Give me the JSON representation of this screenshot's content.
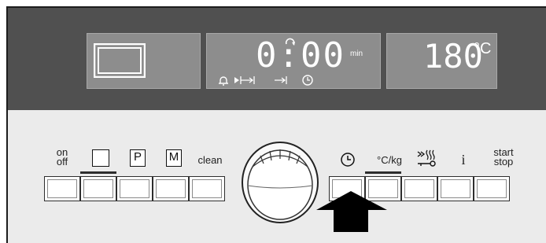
{
  "display": {
    "timer_value": "0:00",
    "timer_unit": "min",
    "timer_icons": [
      "bell-icon",
      "play-to-end-icon",
      "end-bracket-icon",
      "clock-icon"
    ],
    "temperature_value": "180",
    "temperature_unit": "°C"
  },
  "left_buttons": [
    {
      "label": "on\noff",
      "symbol": "power"
    },
    {
      "label": "",
      "symbol": "empty-square"
    },
    {
      "label": "P",
      "symbol": "boxed-letter"
    },
    {
      "label": "M",
      "symbol": "boxed-letter"
    },
    {
      "label": "clean",
      "symbol": "text"
    }
  ],
  "right_buttons": [
    {
      "label": "",
      "symbol": "clock-icon"
    },
    {
      "label": "°C/kg",
      "symbol": "text"
    },
    {
      "label": "",
      "symbol": "steam-lock-icon"
    },
    {
      "label": "i",
      "symbol": "info-icon"
    },
    {
      "label": "start\nstop",
      "symbol": "text"
    }
  ],
  "arrow_target": "clock-button"
}
